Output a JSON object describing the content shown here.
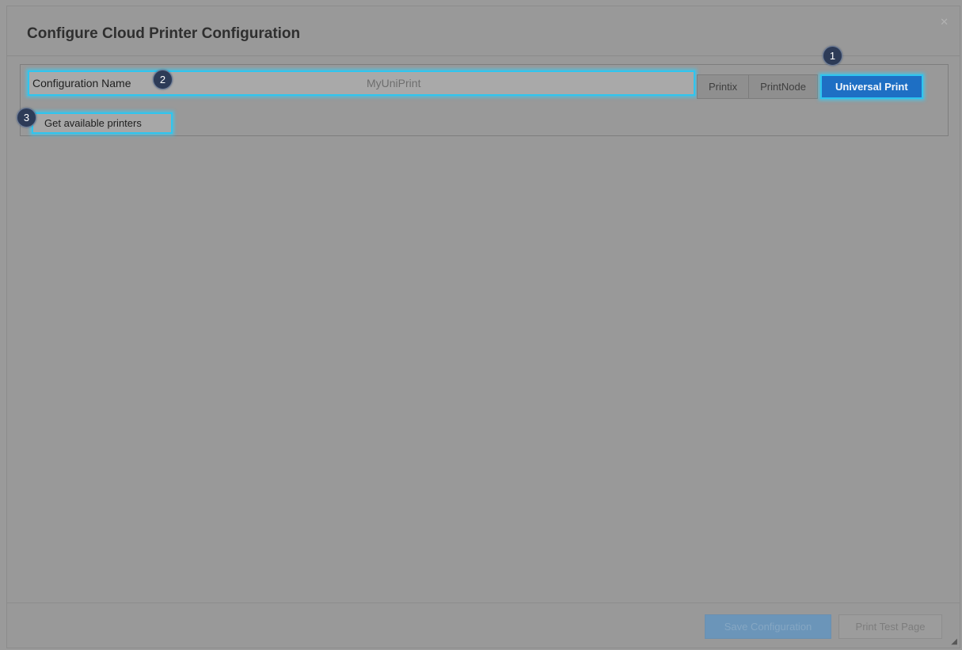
{
  "dialog": {
    "title": "Configure Cloud Printer Configuration",
    "close_icon": "close-icon"
  },
  "config": {
    "name_label": "Configuration Name",
    "name_value": "MyUniPrint",
    "providers": [
      {
        "label": "Printix",
        "active": false
      },
      {
        "label": "PrintNode",
        "active": false
      },
      {
        "label": "Universal Print",
        "active": true
      }
    ],
    "get_printers_label": "Get available printers"
  },
  "badges": [
    "1",
    "2",
    "3"
  ],
  "footer": {
    "save_label": "Save Configuration",
    "test_label": "Print Test Page"
  },
  "colors": {
    "highlight": "#2fc5ef",
    "active_provider": "#1e6fc4",
    "badge": "#2d3b57"
  }
}
